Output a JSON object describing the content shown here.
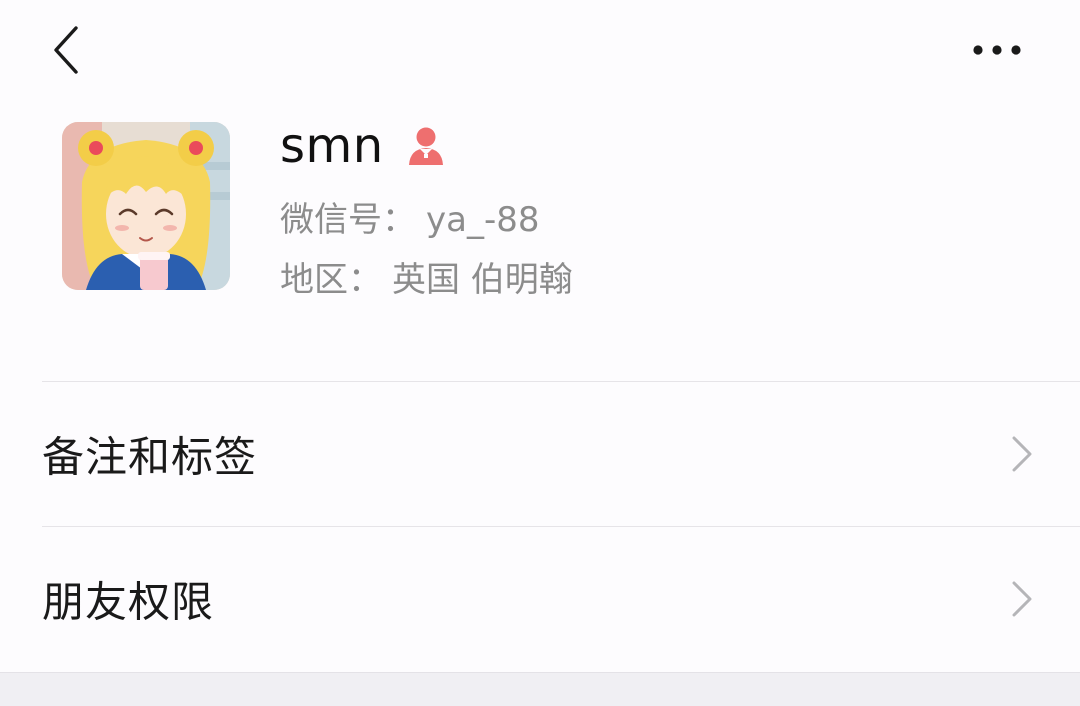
{
  "profile": {
    "nickname": "smn",
    "gender": "female",
    "gender_color": "#ee6f6f",
    "wechat_id_label": "微信号：",
    "wechat_id_value": "ya_-88",
    "region_label": "地区：",
    "region_value": "英国 伯明翰"
  },
  "nav": {
    "back_icon": "chevron-left-icon",
    "more_icon": "more-horizontal-icon"
  },
  "menu": {
    "items": [
      {
        "label": "备注和标签",
        "icon": "chevron-right-icon"
      },
      {
        "label": "朋友权限",
        "icon": "chevron-right-icon"
      }
    ]
  },
  "colors": {
    "background": "#fdfcfe",
    "text_primary": "#111111",
    "text_secondary": "#8c8c8c",
    "chevron": "#b5b5b8",
    "divider": "#e6e4e8"
  }
}
